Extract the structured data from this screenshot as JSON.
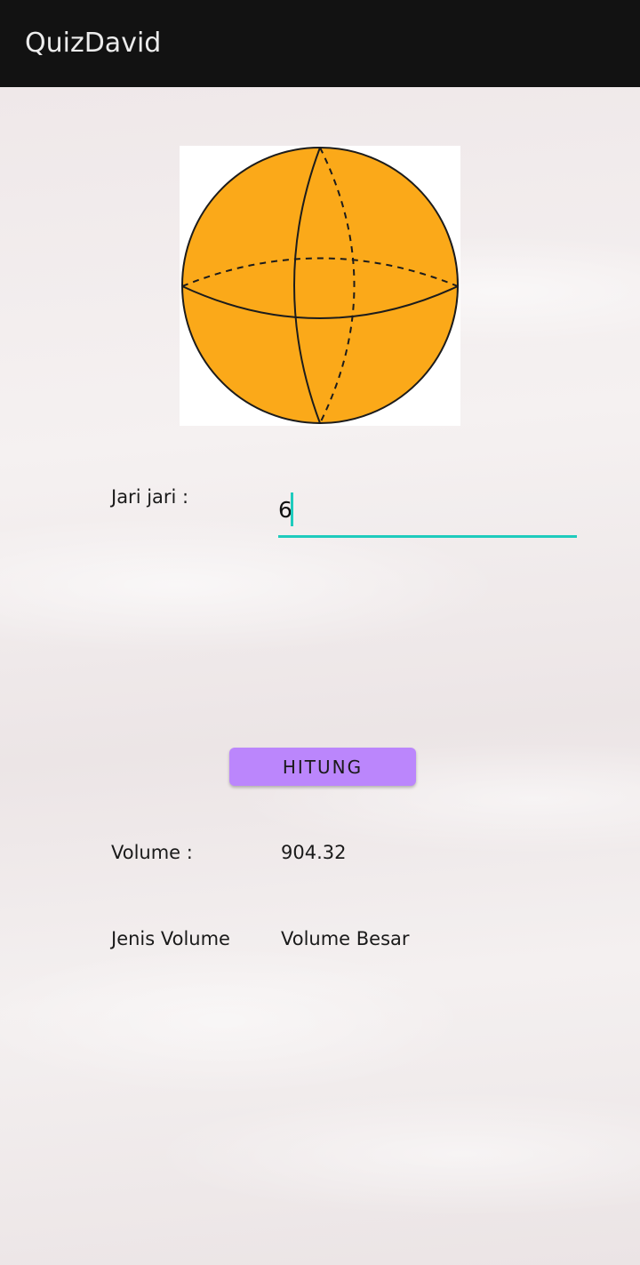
{
  "app_bar": {
    "title": "QuizDavid"
  },
  "sphere_image": {
    "icon": "sphere-icon",
    "fill_color": "#fba919",
    "stroke_color": "#1c1c1c"
  },
  "form": {
    "radius_label": "Jari jari :",
    "radius_value": "6",
    "accent_color": "#1fcbbd"
  },
  "button": {
    "label": "HITUNG",
    "color": "#bb86fc"
  },
  "results": {
    "volume_label": "Volume :",
    "volume_value": "904.32",
    "type_label": "Jenis Volume",
    "type_value": "Volume Besar"
  }
}
